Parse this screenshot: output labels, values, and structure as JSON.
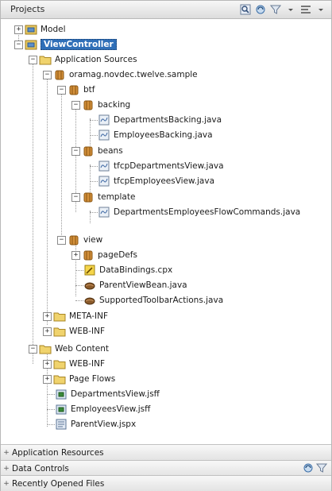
{
  "panel": {
    "title": "Projects"
  },
  "toolbar": {
    "icons": [
      "find-icon",
      "sync-icon",
      "filter-icon",
      "options-icon"
    ]
  },
  "tree": {
    "model": "Model",
    "viewcontroller": "ViewController",
    "application_sources": "Application Sources",
    "package": "oramag.novdec.twelve.sample",
    "btf": "btf",
    "backing": "backing",
    "departments_backing": "DepartmentsBacking.java",
    "employees_backing": "EmployeesBacking.java",
    "beans": "beans",
    "tfcp_departments": "tfcpDepartmentsView.java",
    "tfcp_employees": "tfcpEmployeesView.java",
    "template": "template",
    "flow_commands": "DepartmentsEmployeesFlowCommands.java",
    "view": "view",
    "pagedefs": "pageDefs",
    "databindings": "DataBindings.cpx",
    "parent_view_bean": "ParentViewBean.java",
    "supported_toolbar": "SupportedToolbarActions.java",
    "meta_inf": "META-INF",
    "web_inf_1": "WEB-INF",
    "web_content": "Web Content",
    "web_inf_2": "WEB-INF",
    "page_flows": "Page Flows",
    "departments_view_jsff": "DepartmentsView.jsff",
    "employees_view_jsff": "EmployeesView.jsff",
    "parent_view_jspx": "ParentView.jspx"
  },
  "accordion": {
    "application_resources": "Application Resources",
    "data_controls": "Data Controls",
    "recently_opened": "Recently Opened Files"
  },
  "colors": {
    "selection": "#2f6fb8",
    "folder": "#e8c45a",
    "package": "#c8841e"
  }
}
